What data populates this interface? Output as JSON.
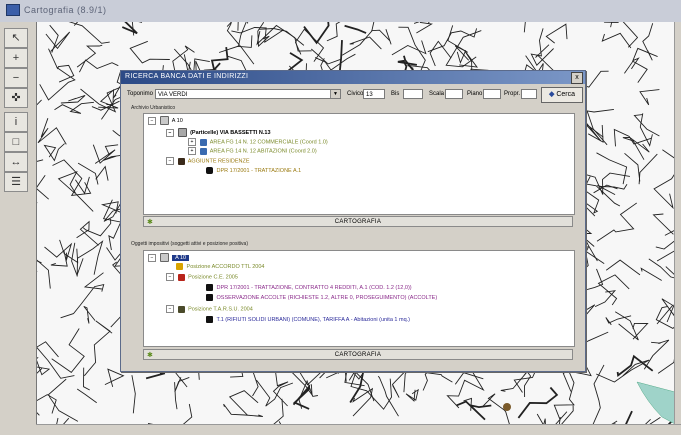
{
  "window": {
    "title": "Cartografia (8.9/1)"
  },
  "toolbar": {
    "tools": [
      {
        "name": "pointer-tool-icon",
        "glyph": "↖"
      },
      {
        "name": "zoom-in-icon",
        "glyph": "+"
      },
      {
        "name": "zoom-out-icon",
        "glyph": "−"
      },
      {
        "name": "pan-icon",
        "glyph": "✜"
      },
      {
        "name": "info-icon",
        "glyph": "i"
      },
      {
        "name": "select-icon",
        "glyph": "□"
      },
      {
        "name": "measure-icon",
        "glyph": "↔"
      },
      {
        "name": "layers-icon",
        "glyph": "☰"
      }
    ]
  },
  "dialog": {
    "title": "RICERCA BANCA DATI E INDIRIZZI",
    "close": "x",
    "search": {
      "label_street": "Toponimo",
      "street_value": "VIA VERDI",
      "label_civico": "Civico",
      "civico_value": "13",
      "label_bis": "Bis",
      "label_scala": "Scala",
      "label_piano": "Piano",
      "label_prop": "Propr.",
      "button_label": "Cerca",
      "button_icon": "◆"
    },
    "section1": {
      "label": "Archivio Urbanistico",
      "footer": "CARTOGRAFIA",
      "rows": [
        {
          "text": "A 10",
          "color": "#000"
        },
        {
          "text": "(Particelle) VIA BASSETTI N.13",
          "color": "#000"
        },
        {
          "text": "AREA FG 14 N. 12 COMMERCIALE (Coord 1.0)",
          "color": "#7a8a2a"
        },
        {
          "text": "AREA FG 14 N. 12 ABITAZIONI (Coord 2.0)",
          "color": "#7a8a2a"
        },
        {
          "text": "AGGIUNTE RESIDENZE",
          "color": "#9a7a10"
        },
        {
          "text": "DPR 17/2001 - TRATTAZIONE A.1",
          "color": "#9a7a10"
        }
      ]
    },
    "section2": {
      "label": "Oggetti impositivi (soggetti attivi e posizione positiva)",
      "footer": "CARTOGRAFIA",
      "rows": [
        {
          "text": "A 10",
          "color": "#fff"
        },
        {
          "text": "Posizione ACCORDO TTL 2004",
          "color": "#7a8a2a"
        },
        {
          "text": "Posizione C.E. 2005",
          "color": "#7a8a2a"
        },
        {
          "text": "DPR 17/2001 - TRATTAZIONE, CONTRATTO 4 REDDITI, A.1 (COD. 1.2 (12,0))",
          "color": "#8a2a8a"
        },
        {
          "text": "OSSERVAZIONE ACCOLTE (RICHIESTE 1.2, ALTRE 0, PROSEGUIMENTO) (ACCOLTE)",
          "color": "#8a2a8a"
        },
        {
          "text": "Posizione T.A.R.S.U. 2004",
          "color": "#7a8a2a"
        },
        {
          "text": "T.1 (RIFIUTI SOLIDI URBANI) (COMUNE), TARIFFA A - Abitazioni (unita 1 mq.)",
          "color": "#2a2a9a"
        }
      ]
    }
  }
}
